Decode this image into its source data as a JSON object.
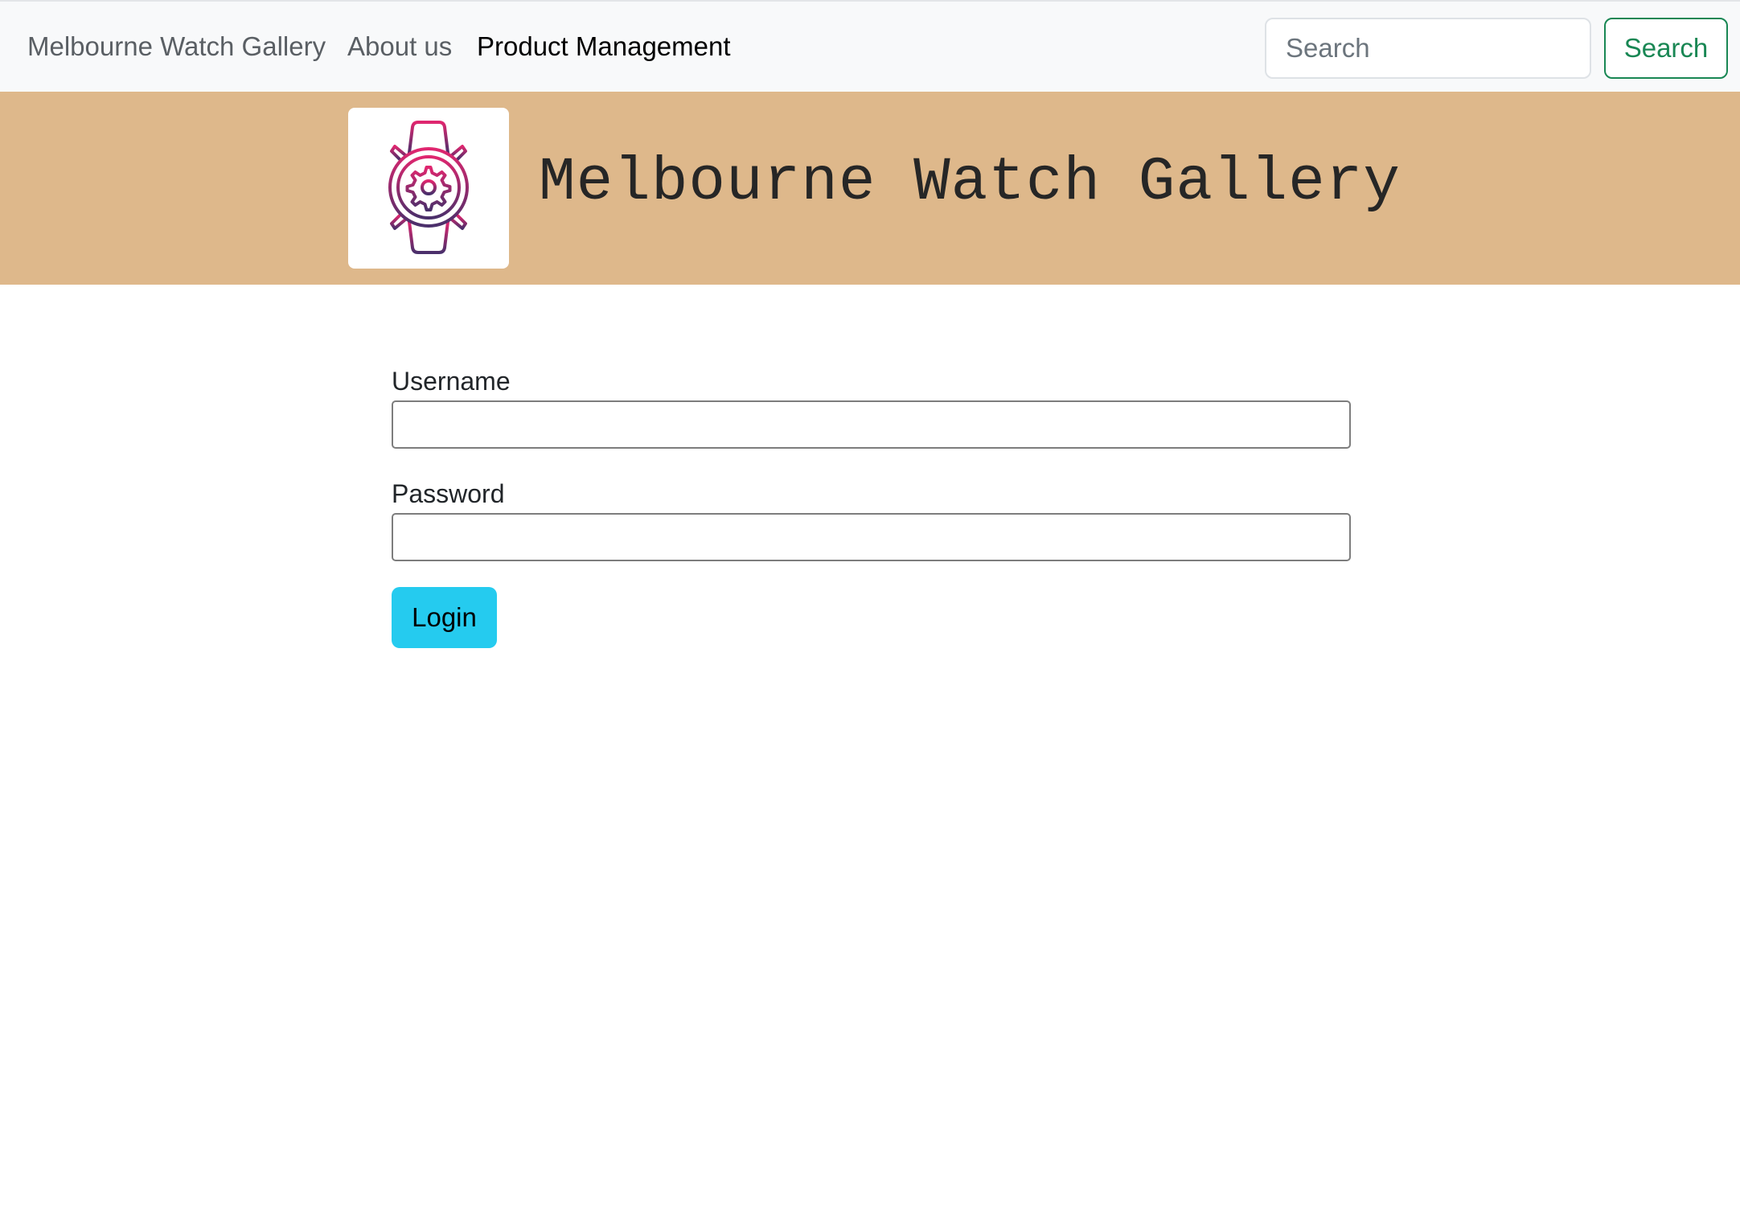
{
  "navbar": {
    "brand_label": "Melbourne Watch Gallery",
    "links": [
      {
        "label": "About us"
      },
      {
        "label": "Product Management",
        "active": true
      }
    ],
    "search": {
      "placeholder": "Search",
      "value": "",
      "button_label": "Search"
    }
  },
  "banner": {
    "title": "Melbourne Watch Gallery",
    "logo_icon": "smartwatch-gear-icon"
  },
  "login_form": {
    "username_label": "Username",
    "username_value": "",
    "password_label": "Password",
    "password_value": "",
    "submit_label": "Login"
  },
  "colors": {
    "navbar_bg": "#f8f9fa",
    "banner_bg": "#deb88b",
    "search_button": "#198754",
    "login_button": "#25cbef",
    "logo_gradient_start": "#e0266f",
    "logo_gradient_end": "#4a2f6b"
  }
}
